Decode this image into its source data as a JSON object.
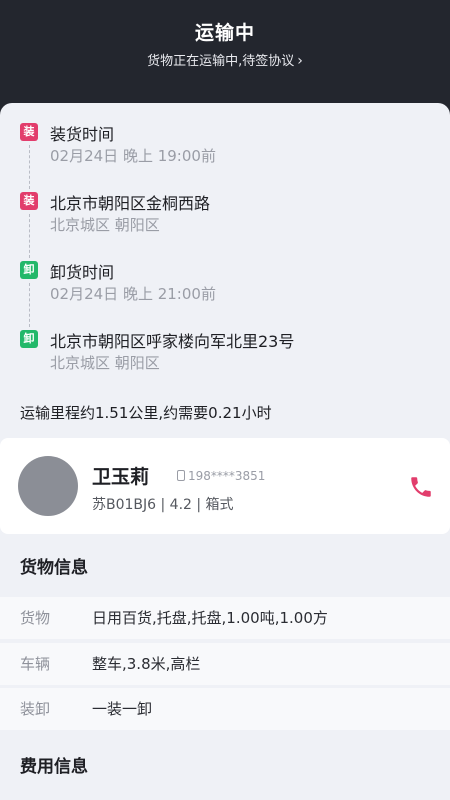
{
  "header": {
    "title": "运输中",
    "subtitle": "货物正在运输中,待签协议",
    "subtitle_chevron": "chevron-right-icon"
  },
  "route": {
    "stops": [
      {
        "badge": "装",
        "type": "load",
        "main": "装货时间",
        "second": "02月24日 晚上 19:00前"
      },
      {
        "badge": "装",
        "type": "load",
        "main": "北京市朝阳区金桐西路",
        "second": "北京城区 朝阳区"
      },
      {
        "badge": "卸",
        "type": "unload",
        "main": "卸货时间",
        "second": "02月24日 晚上 21:00前"
      },
      {
        "badge": "卸",
        "type": "unload",
        "main": "北京市朝阳区呼家楼向军北里23号",
        "second": "北京城区 朝阳区"
      }
    ],
    "distance_text": "运输里程约1.51公里,约需要0.21小时"
  },
  "driver": {
    "name": "卫玉莉",
    "phone": "198****3851",
    "vehicle": "苏B01BJ6 | 4.2 | 箱式",
    "phone_icon": "phone-icon",
    "call_icon": "call-icon"
  },
  "cargo": {
    "title": "货物信息",
    "rows": [
      {
        "key": "货物",
        "value": "日用百货,托盘,托盘,1.00吨,1.00方"
      },
      {
        "key": "车辆",
        "value": "整车,3.8米,高栏"
      },
      {
        "key": "装卸",
        "value": "一装一卸"
      }
    ]
  },
  "fees": {
    "title": "费用信息"
  },
  "colors": {
    "header_bg": "#23262e",
    "load_badge": "#e23d6c",
    "unload_badge": "#23b86a",
    "call_accent": "#e23d6c"
  }
}
